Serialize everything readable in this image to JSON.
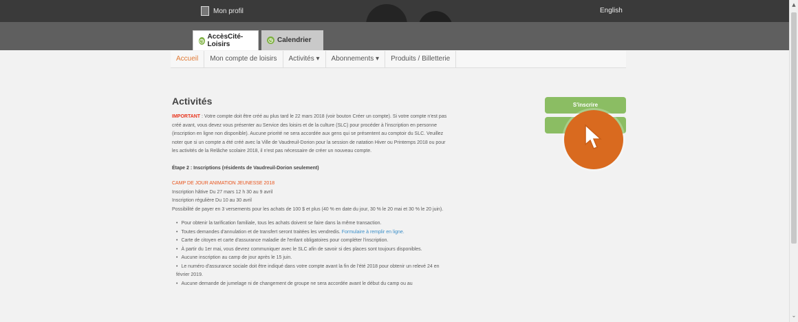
{
  "header": {
    "profile_label": "Mon profil",
    "language_link": "English"
  },
  "tabs": [
    {
      "label": "AccèsCité-Loisirs",
      "active": true
    },
    {
      "label": "Calendrier",
      "active": false
    }
  ],
  "nav": {
    "items": [
      {
        "label": "Accueil",
        "active": true
      },
      {
        "label": "Mon compte de loisirs"
      },
      {
        "label": "Activités ▾"
      },
      {
        "label": "Abonnements ▾"
      },
      {
        "label": "Produits / Billetterie"
      }
    ]
  },
  "main": {
    "title": "Activités",
    "important_label": "IMPORTANT",
    "important_text": " : Votre compte doit être créé au plus tard le 22 mars 2018 (voir bouton Créer un compte). Si votre compte n'est pas créé avant, vous devez vous présenter au Service des loisirs et de la culture (SLC) pour procéder à l'inscription en personne (inscription en ligne non disponible). Aucune priorité ne sera accordée aux gens qui se présentent au comptoir du SLC. Veuillez noter que si un compte a été créé avec la Ville de Vaudreuil-Dorion pour la session de natation Hiver ou Printemps 2018 ou pour les activités de la Relâche scolaire 2018, il n'est pas nécessaire de créer un nouveau compte.",
    "step_title": "Étape 2 : Inscriptions (résidents de Vaudreuil-Dorion seulement)",
    "camp_title": "CAMP DE JOUR ANIMATION JEUNESSE 2018",
    "lines": [
      "Inscription hâtive    Du 27 mars 12 h 30 au 9 avril",
      "Inscription régulière  Du 10 au 30 avril",
      "Possibilité de payer en 3 versements pour les achats de 100 $ et plus (40 % en date du jour, 30 % le 20 mai et 30 % le 20 juin)."
    ],
    "bullets": [
      {
        "text": "Pour obtenir la tarification familiale, tous les achats doivent se faire dans la même transaction."
      },
      {
        "text": "Toutes demandes d'annulation et de transfert seront traitées les vendredis. ",
        "link": "Formulaire à remplir en ligne."
      },
      {
        "text": "Carte de citoyen et carte d'assurance maladie de l'enfant obligatoires pour compléter l'inscription."
      },
      {
        "text": "À partir du 1er mai, vous devrez communiquer avec le SLC afin de savoir si des places sont toujours disponibles."
      },
      {
        "text": "Aucune inscription au camp de jour après le 15 juin."
      },
      {
        "text": "Le numéro d'assurance sociale doit être indiqué dans votre compte avant la fin de l'été 2018 pour obtenir un relevé 24 en février 2019."
      },
      {
        "text": "Aucune demande de jumelage ni de changement de groupe ne sera accordée avant le début du camp ou au"
      }
    ]
  },
  "sidebar": {
    "register_button": "S'inscrire"
  },
  "colors": {
    "accent_orange": "#e07a35",
    "button_green": "#8bbd63",
    "important_red": "#e8341c"
  }
}
